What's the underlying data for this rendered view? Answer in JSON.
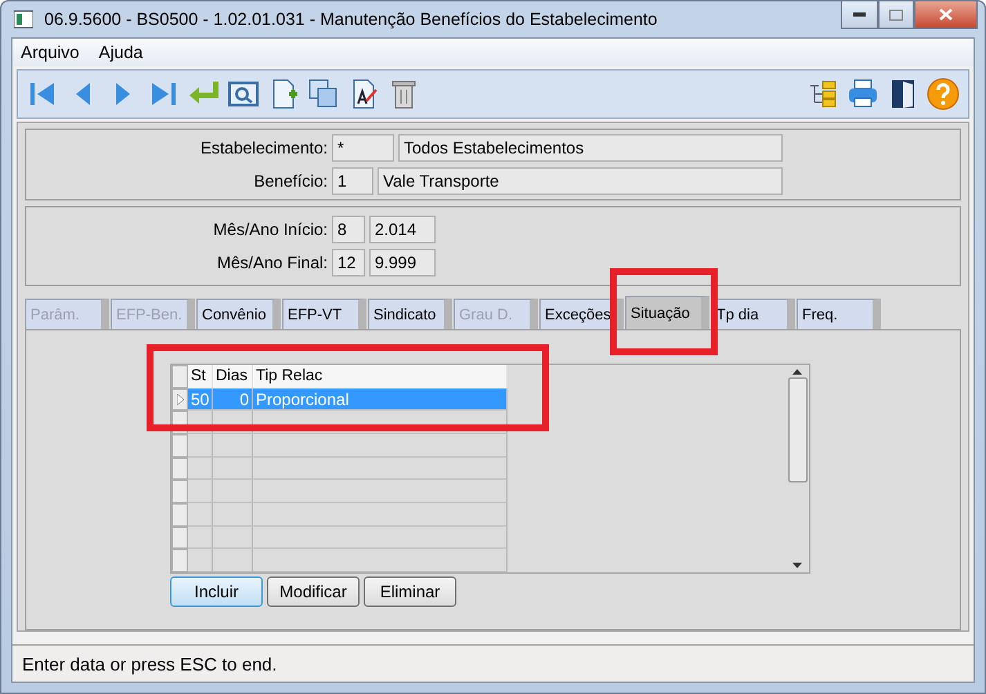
{
  "window": {
    "title": "06.9.5600 - BS0500 - 1.02.01.031 - Manutenção Benefícios do Estabelecimento"
  },
  "menu": [
    {
      "label": "Arquivo"
    },
    {
      "label": "Ajuda"
    }
  ],
  "header": {
    "fields": [
      {
        "label": "Estabelecimento:",
        "code": "*",
        "description": "Todos Estabelecimentos",
        "kind": "wide"
      },
      {
        "label": "Benefício:",
        "code": "1",
        "description": "Vale Transporte",
        "kind": "narrow"
      }
    ]
  },
  "period": {
    "fields": [
      {
        "label": "Mês/Ano Início:",
        "month": "8",
        "year": "2.014"
      },
      {
        "label": "Mês/Ano Final:",
        "month": "12",
        "year": "9.999"
      }
    ]
  },
  "tabs": [
    {
      "label": "Parâm.",
      "selected": false,
      "disabled": true
    },
    {
      "label": "EFP-Ben.",
      "selected": false,
      "disabled": true
    },
    {
      "label": "Convênio",
      "selected": false,
      "disabled": false
    },
    {
      "label": "EFP-VT",
      "selected": false,
      "disabled": false
    },
    {
      "label": "Sindicato",
      "selected": false,
      "disabled": false
    },
    {
      "label": "Grau D.",
      "selected": false,
      "disabled": true
    },
    {
      "label": "Exceções",
      "selected": false,
      "disabled": false
    },
    {
      "label": "Situação",
      "selected": true,
      "disabled": false
    },
    {
      "label": "Tp dia",
      "selected": false,
      "disabled": false
    },
    {
      "label": "Freq.",
      "selected": false,
      "disabled": false
    }
  ],
  "grid": {
    "columns": [
      "St",
      "Dias",
      "Tip Relac"
    ],
    "rows": [
      {
        "cells": [
          "50",
          "0",
          "Proporcional"
        ],
        "selected": true
      }
    ]
  },
  "buttons": [
    {
      "label": "Incluir",
      "focused": true
    },
    {
      "label": "Modificar",
      "focused": false
    },
    {
      "label": "Eliminar",
      "focused": false
    }
  ],
  "status_bar": "Enter data or press ESC to end."
}
